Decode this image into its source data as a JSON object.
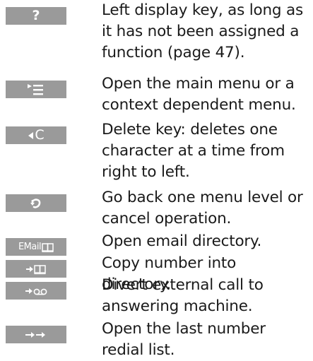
{
  "rows": [
    {
      "key_label": "?",
      "key_icon": "question-mark",
      "description": "Left display key, as long as it has not been assigned a function (page 47)."
    },
    {
      "key_label": "",
      "key_icon": "menu-icon",
      "description": "Open the main menu or a context dependent menu."
    },
    {
      "key_label": "C",
      "key_icon": "delete-icon",
      "description": "Delete key: deletes one character at a time from right to left."
    },
    {
      "key_label": "",
      "key_icon": "back-arrow-icon",
      "description": "Go back one menu level or cancel operation."
    },
    {
      "key_label": "EMail",
      "key_icon": "book-icon",
      "description": "Open email directory."
    },
    {
      "key_label": "",
      "key_icon": "copy-to-directory-icon",
      "description": "Copy number into directory."
    },
    {
      "key_label": "",
      "key_icon": "divert-to-answering-machine-icon",
      "description": "Divert external call to answering machine."
    },
    {
      "key_label": "",
      "key_icon": "redial-list-icon",
      "description": "Open the last number redial list."
    }
  ],
  "colors": {
    "key_background": "#9a9a9a",
    "key_foreground": "#ffffff",
    "text": "#1a1a1a"
  }
}
